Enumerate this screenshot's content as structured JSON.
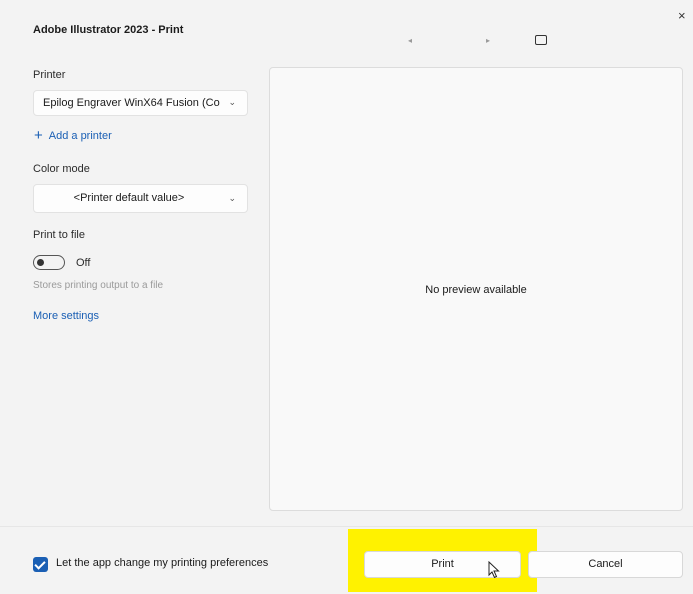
{
  "dialog": {
    "title": "Adobe Illustrator 2023 - Print",
    "close_glyph": "×",
    "prev_glyph": "◂",
    "next_glyph": "▸"
  },
  "printer": {
    "label": "Printer",
    "selected": "Epilog Engraver WinX64 Fusion (Co",
    "add_label": "Add a printer"
  },
  "color_mode": {
    "label": "Color mode",
    "selected": "<Printer default value>"
  },
  "print_to_file": {
    "label": "Print to file",
    "state": "Off",
    "hint": "Stores printing output to a file"
  },
  "more_settings": "More settings",
  "preview": {
    "message": "No preview available"
  },
  "footer": {
    "checkbox_label": "Let the app change my printing preferences",
    "checkbox_checked": true,
    "print_label": "Print",
    "cancel_label": "Cancel"
  },
  "colors": {
    "accent": "#1a5fb4",
    "highlight": "#fff200",
    "background": "#f3f3f3"
  },
  "icons": [
    "close-icon",
    "previous-page-icon",
    "next-page-icon",
    "fit-to-window-icon",
    "chevron-down-icon",
    "plus-icon",
    "checkmark-icon",
    "mouse-pointer-icon"
  ]
}
